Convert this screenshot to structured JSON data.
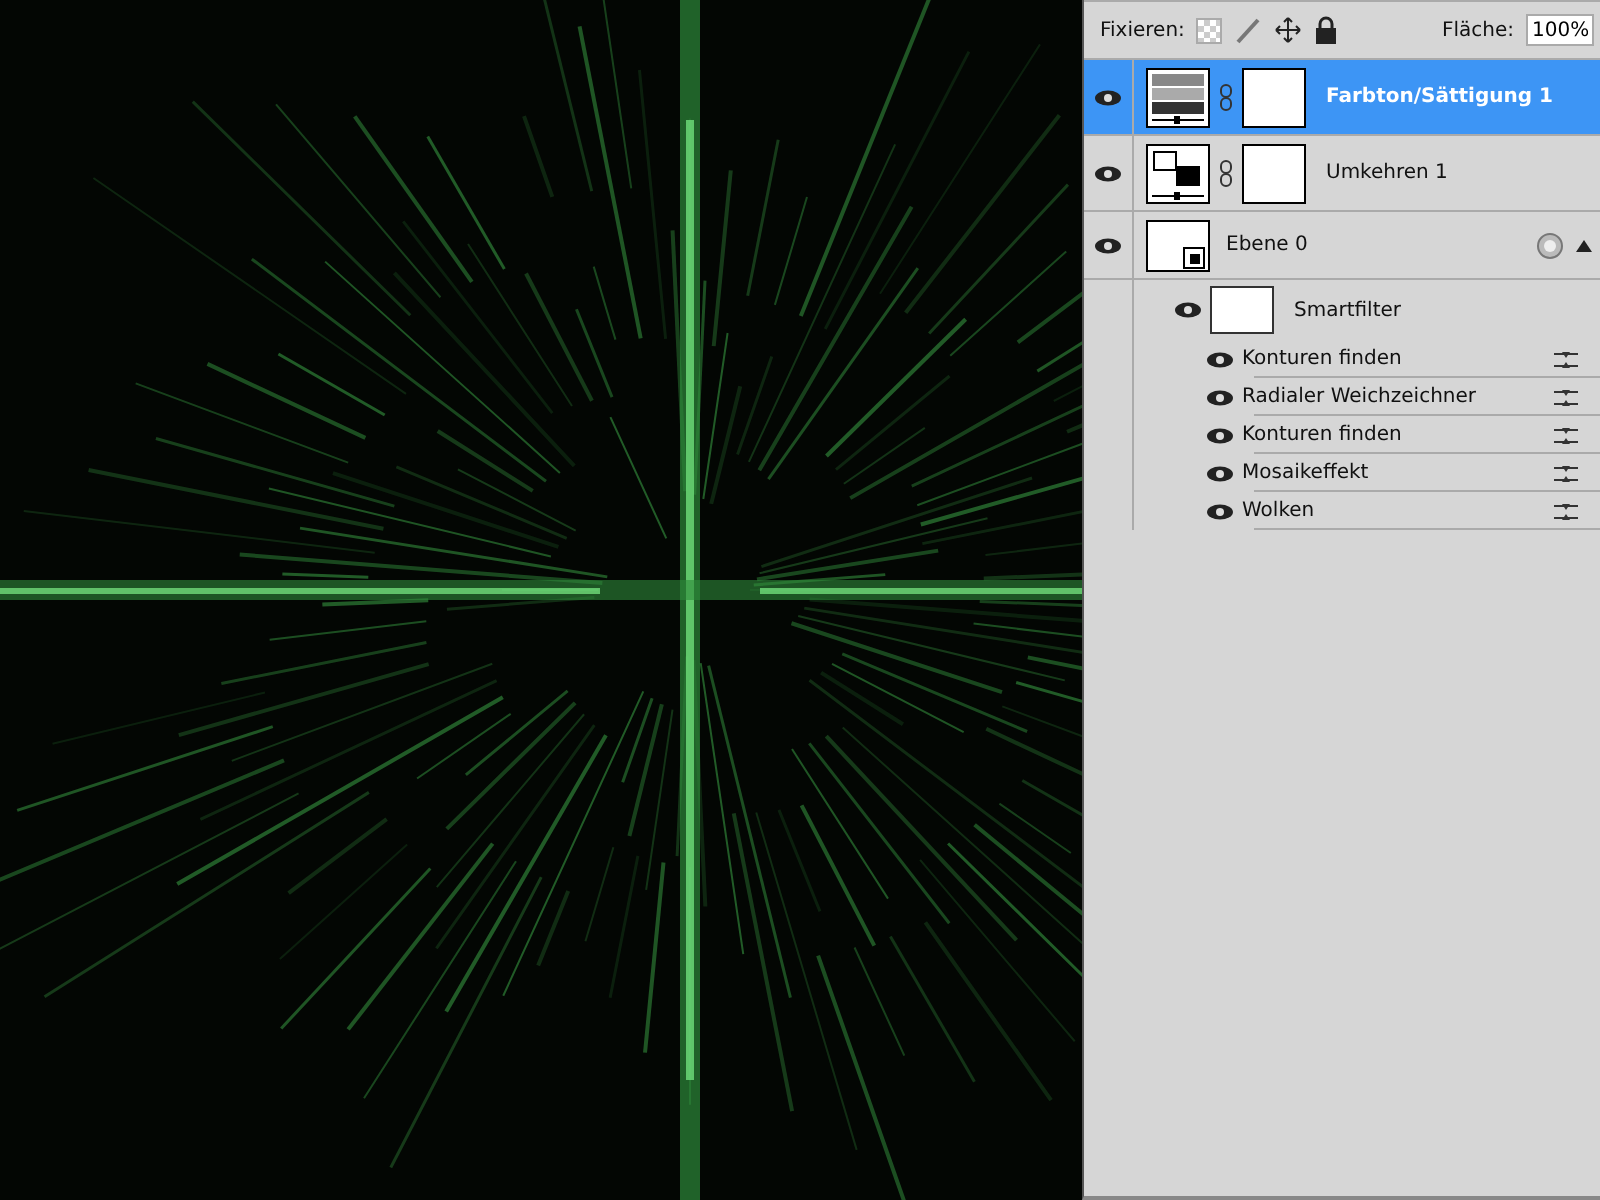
{
  "lock_bar": {
    "label": "Fixieren:",
    "fill_label": "Fläche:",
    "fill_value": "100%"
  },
  "layers": [
    {
      "kind": "huesat",
      "name": "Farbton/Sättigung 1",
      "visible": true,
      "selected": true
    },
    {
      "kind": "invert",
      "name": "Umkehren 1",
      "visible": true,
      "selected": false
    },
    {
      "kind": "smart",
      "name": "Ebene 0",
      "visible": true,
      "selected": false
    }
  ],
  "smartfilter": {
    "name": "Smartfilter",
    "visible": true,
    "filters": [
      {
        "name": "Konturen finden",
        "visible": true
      },
      {
        "name": "Radialer Weichzeichner",
        "visible": true
      },
      {
        "name": "Konturen finden",
        "visible": true
      },
      {
        "name": "Mosaikeffekt",
        "visible": true
      },
      {
        "name": "Wolken",
        "visible": true
      }
    ]
  }
}
